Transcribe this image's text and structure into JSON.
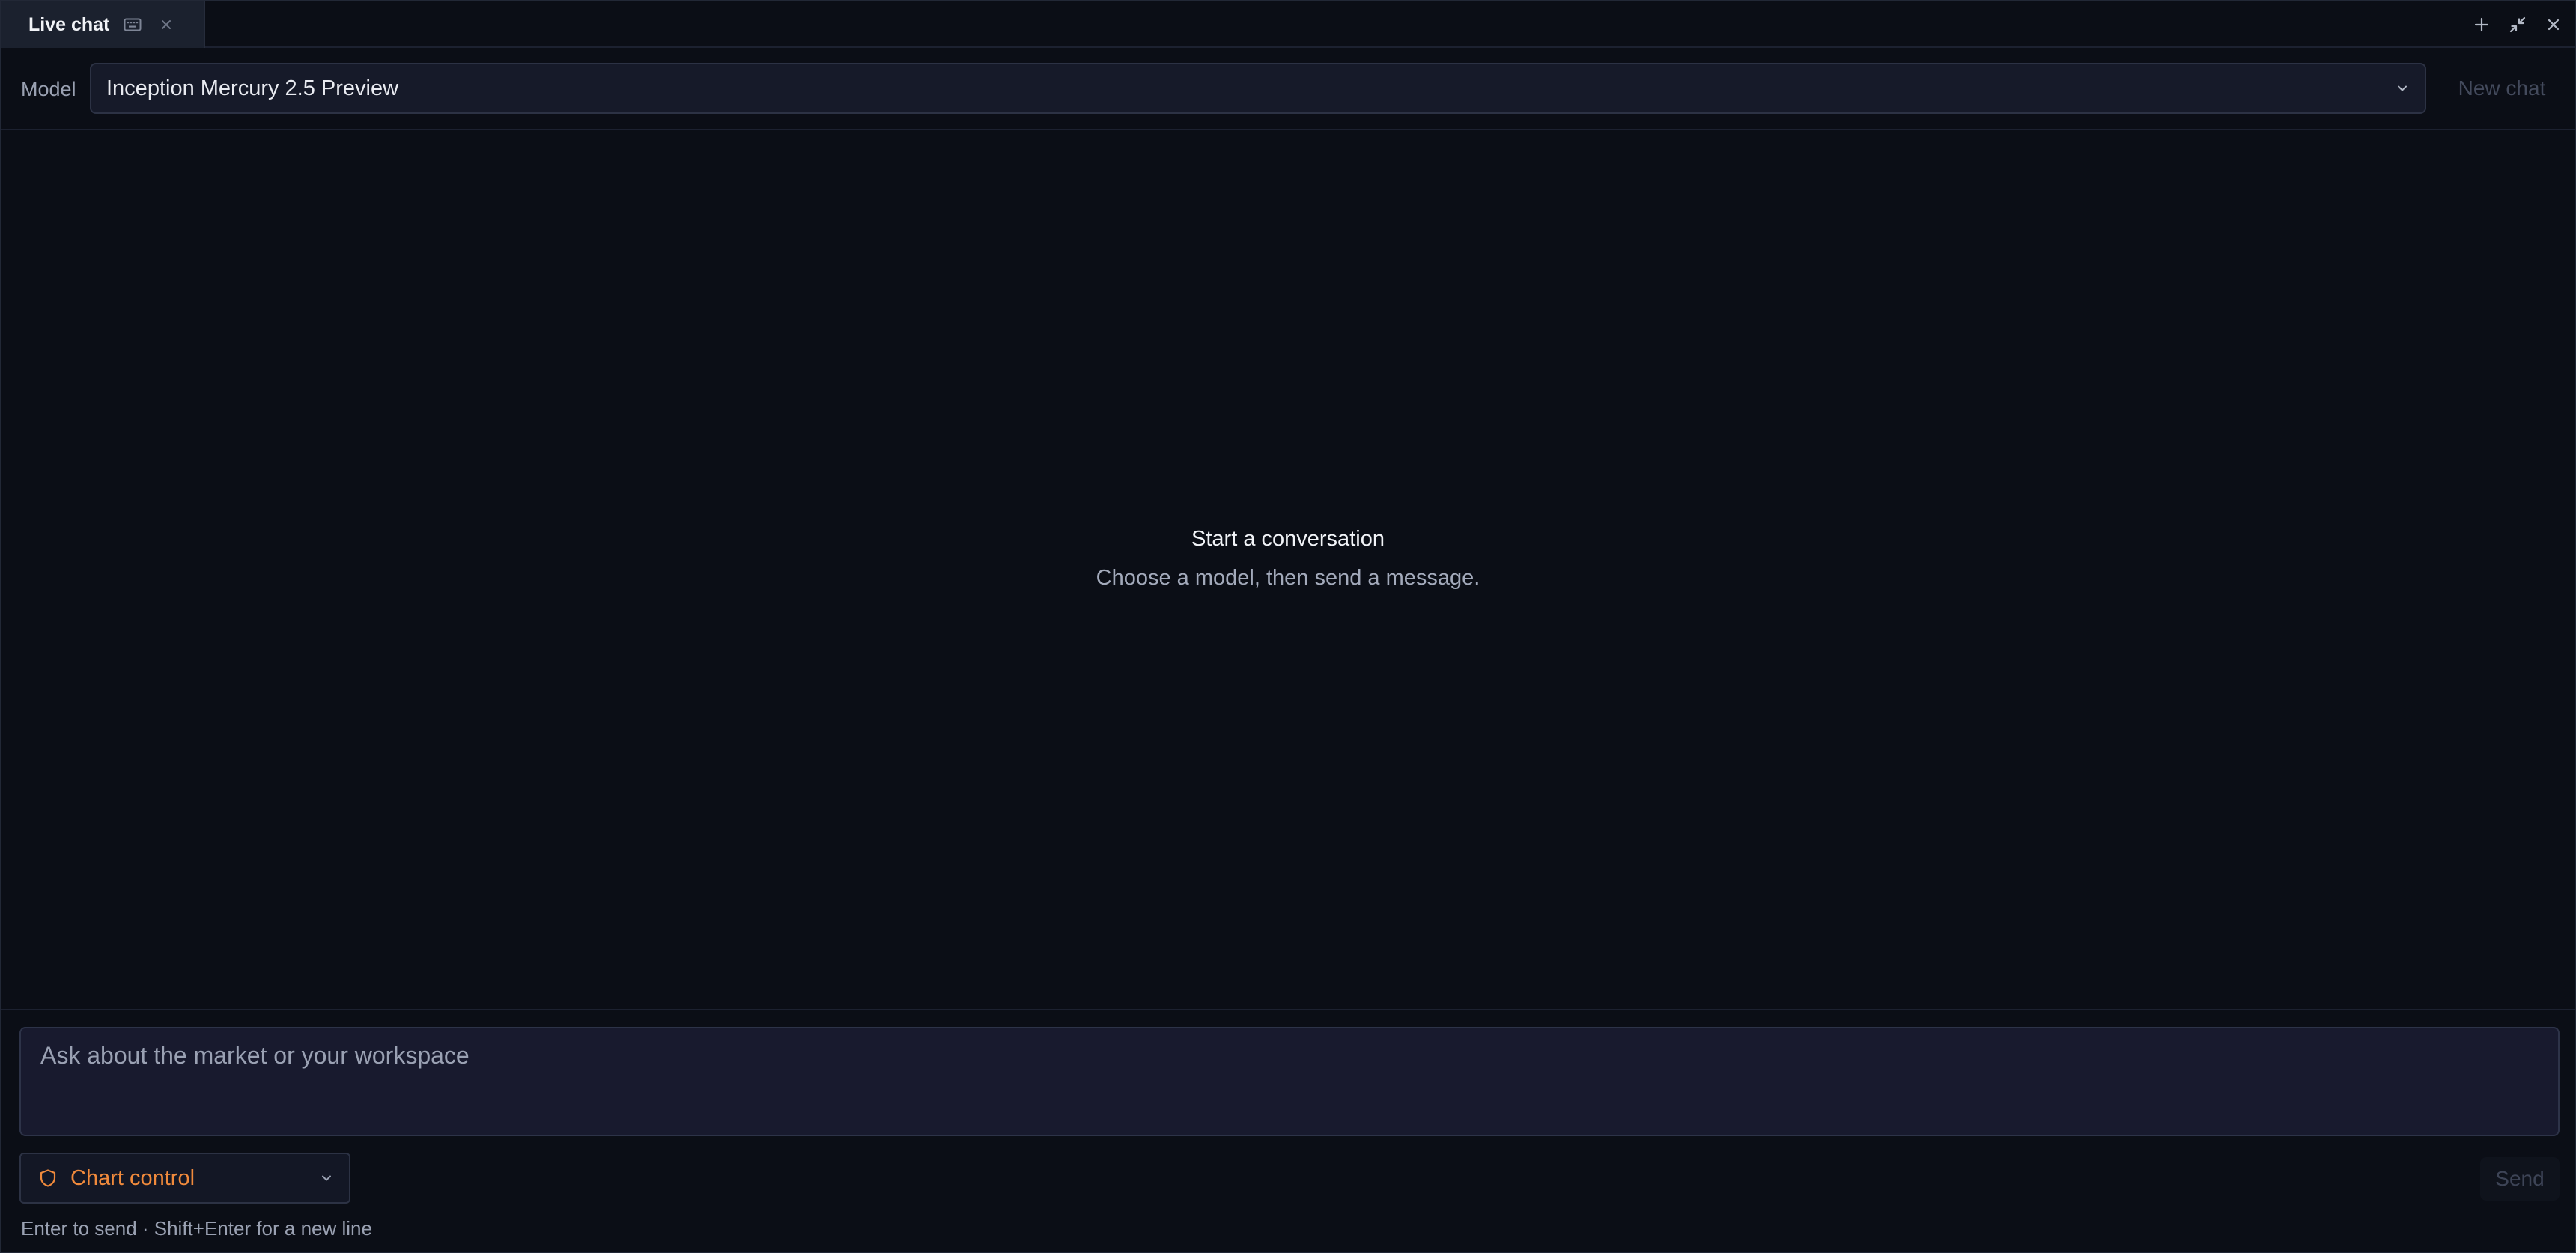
{
  "tab": {
    "title": "Live chat",
    "icons": [
      "keyboard-icon",
      "close-icon"
    ]
  },
  "window_controls": [
    "plus-icon",
    "collapse-icon",
    "close-icon"
  ],
  "model": {
    "label": "Model",
    "selected": "Inception Mercury 2.5 Preview",
    "new_chat_label": "New chat"
  },
  "empty_state": {
    "title": "Start a conversation",
    "subtitle": "Choose a model, then send a message."
  },
  "composer": {
    "placeholder": "Ask about the market or your workspace",
    "mode_label": "Chart control",
    "mode_icon": "shield-icon",
    "send_label": "Send",
    "hint": "Enter to send · Shift+Enter for a new line"
  },
  "colors": {
    "background": "#0b0e16",
    "accent_orange": "#f08a3c",
    "input_bg": "#181a2e",
    "muted_text": "#9aa1b2"
  }
}
